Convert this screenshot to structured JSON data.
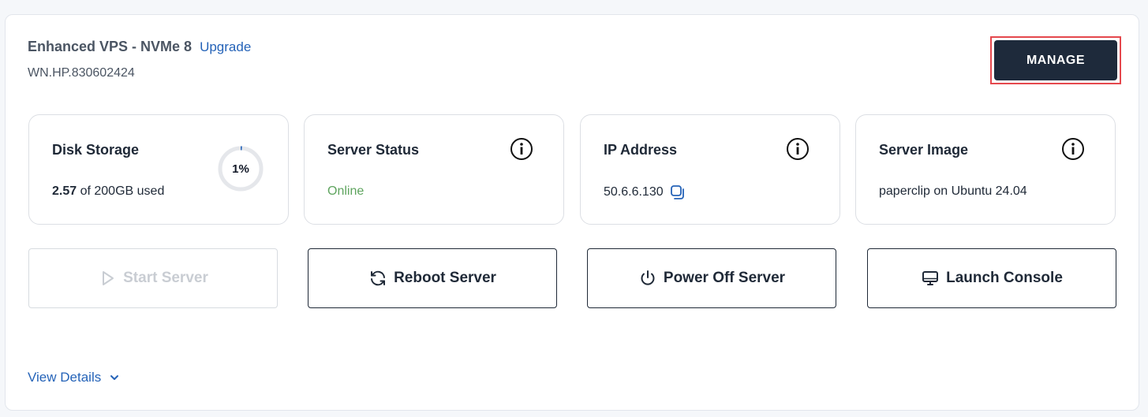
{
  "header": {
    "plan_name": "Enhanced VPS - NVMe 8",
    "upgrade_label": "Upgrade",
    "server_id": "WN.HP.830602424",
    "manage_label": "MANAGE"
  },
  "stats": {
    "disk": {
      "title": "Disk Storage",
      "used": "2.57",
      "of_text": "of 200GB used",
      "percent_label": "1%",
      "percent": 1
    },
    "status": {
      "title": "Server Status",
      "value": "Online",
      "icon": "info-icon"
    },
    "ip": {
      "title": "IP Address",
      "value": "50.6.6.130",
      "icon": "info-icon",
      "copy_icon": "copy-icon"
    },
    "image": {
      "title": "Server Image",
      "value": "paperclip on Ubuntu 24.04",
      "icon": "info-icon"
    }
  },
  "actions": {
    "start": {
      "label": "Start Server",
      "icon": "play-icon",
      "enabled": false
    },
    "reboot": {
      "label": "Reboot Server",
      "icon": "refresh-icon",
      "enabled": true
    },
    "power_off": {
      "label": "Power Off Server",
      "icon": "power-icon",
      "enabled": true
    },
    "console": {
      "label": "Launch Console",
      "icon": "monitor-icon",
      "enabled": true
    }
  },
  "footer": {
    "view_details_label": "View Details"
  },
  "colors": {
    "accent_link": "#2563b8",
    "manage_bg": "#1e2a3b",
    "highlight_border": "#e5484d",
    "online": "#5ea45e",
    "gauge_track": "#e5e7eb",
    "gauge_fill": "#2563b8"
  }
}
